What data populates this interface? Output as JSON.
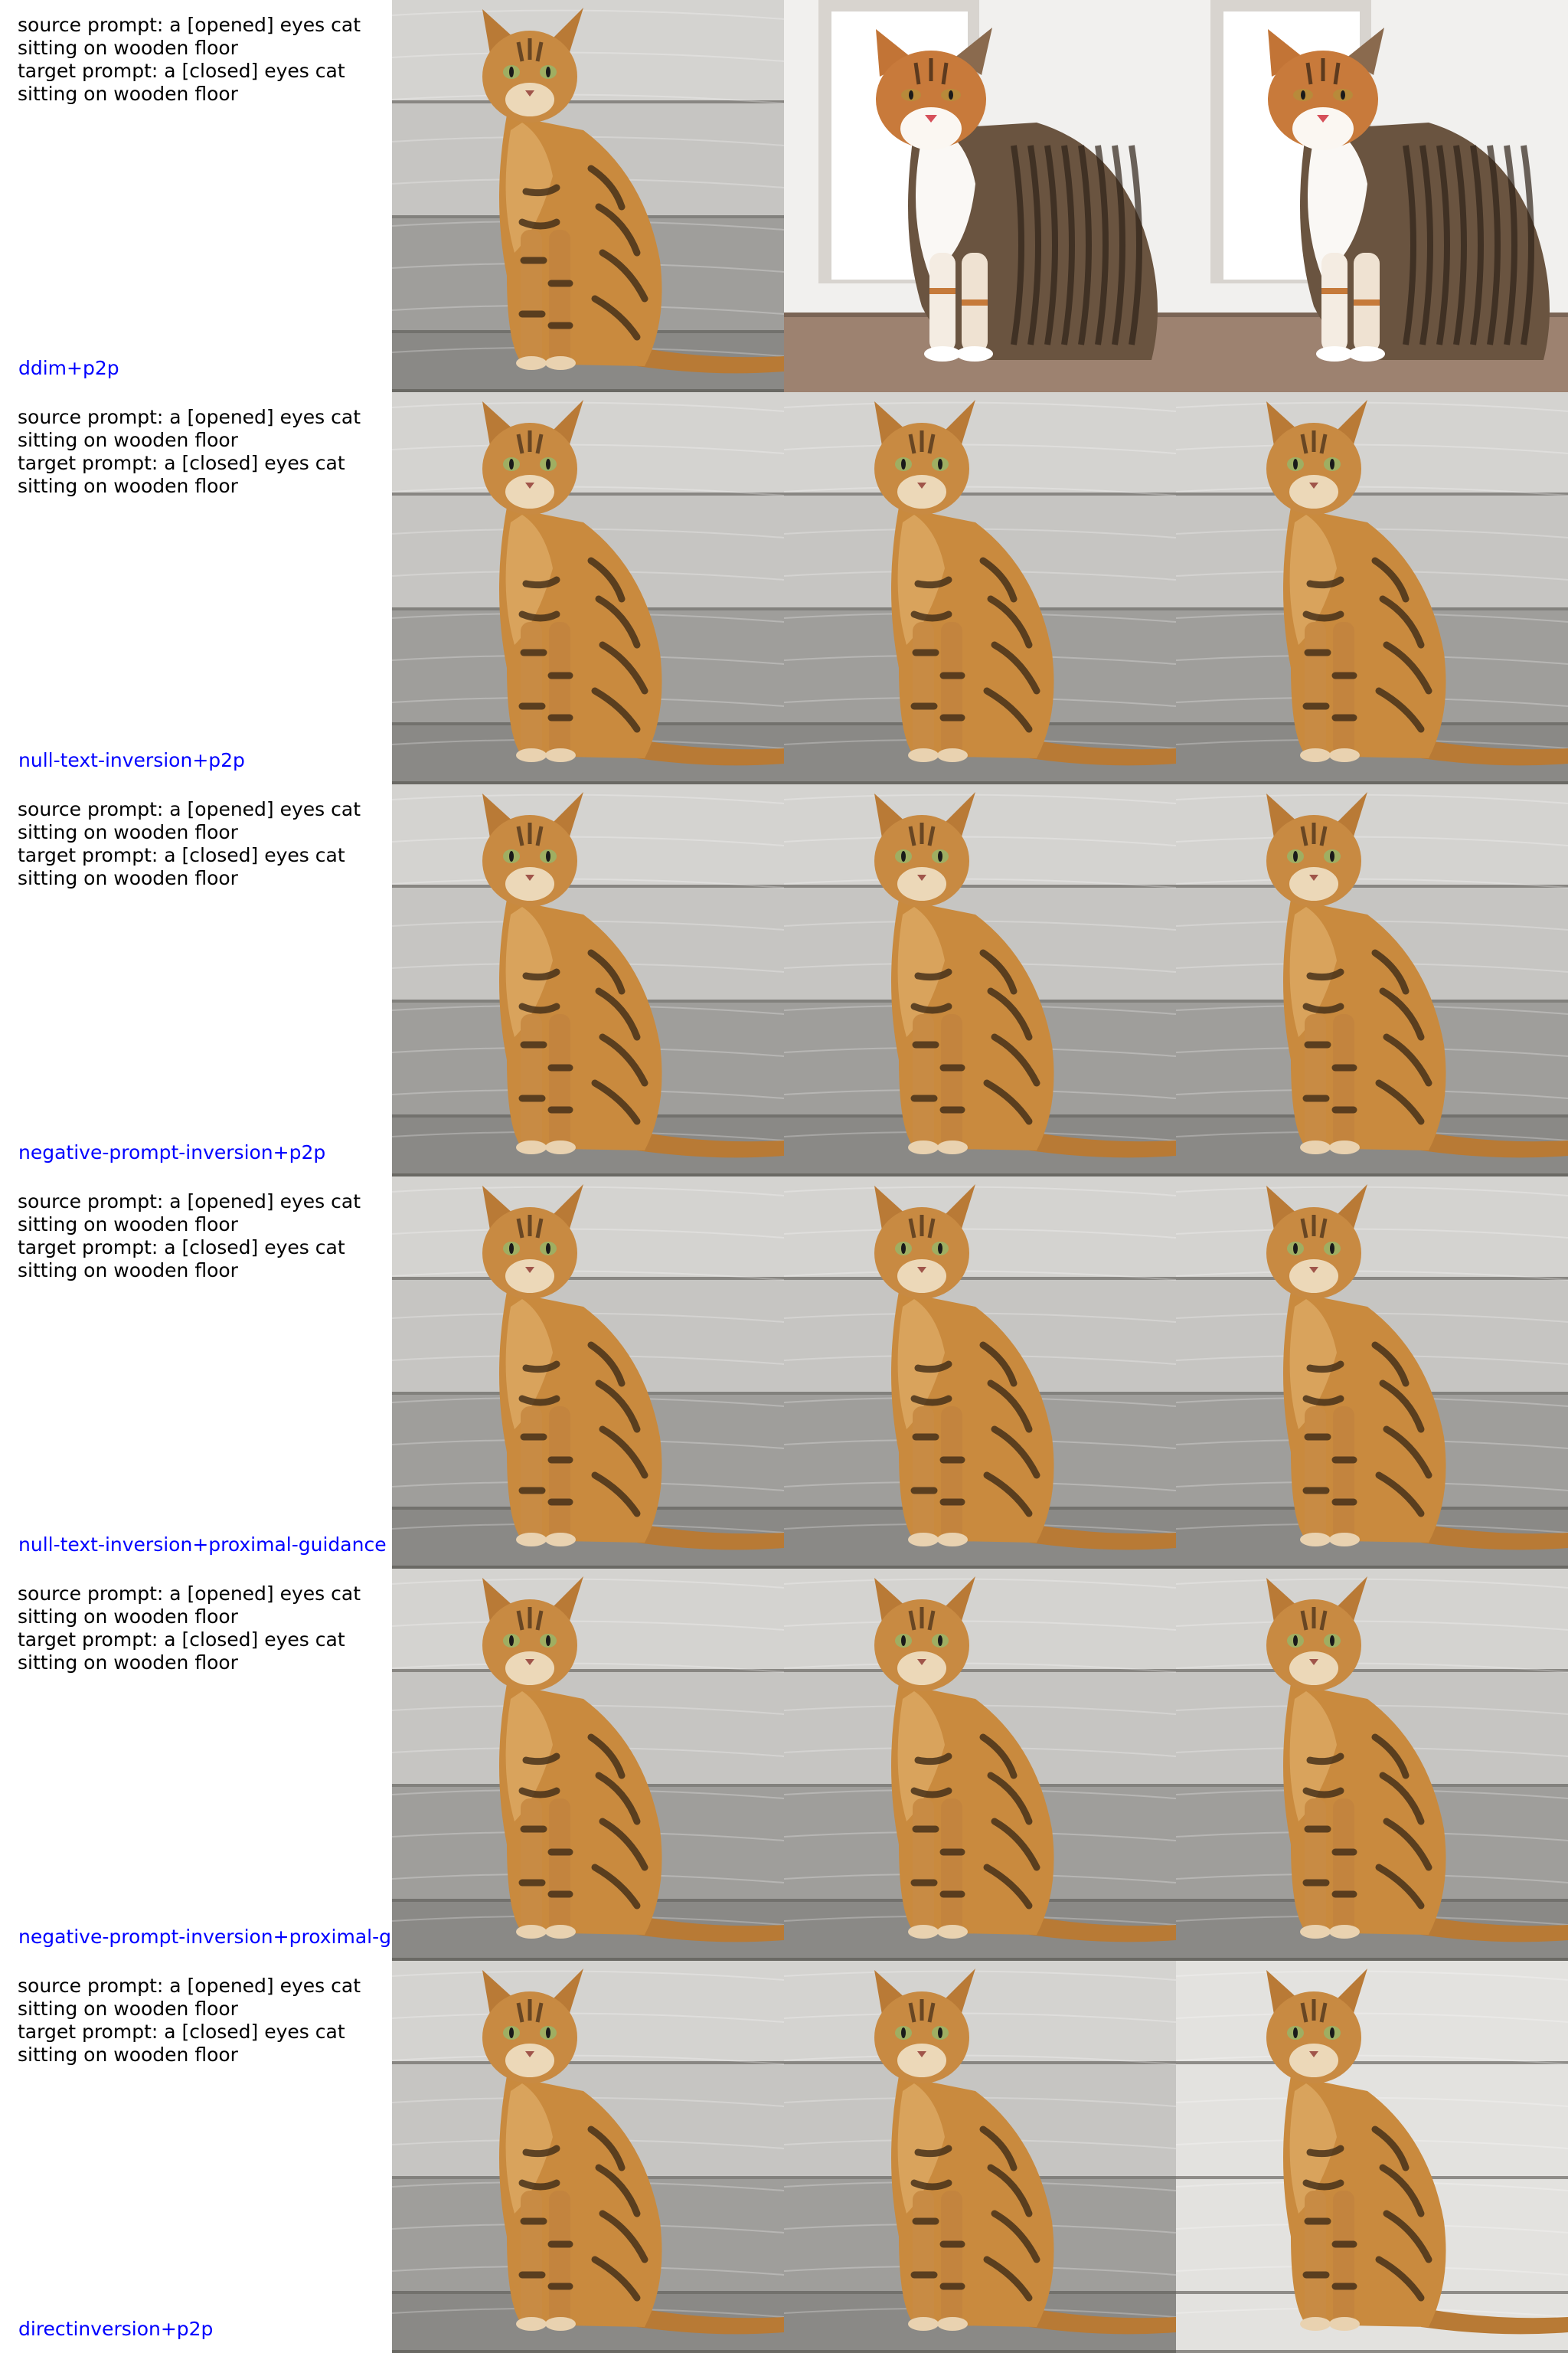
{
  "label_color": "#0000ff",
  "rows": [
    {
      "prompt": "source prompt: a [opened] eyes cat\nsitting on wooden floor\ntarget prompt: a [closed] eyes cat\nsitting on wooden floor",
      "method": "ddim+p2p",
      "images": [
        {
          "icon": "tabby-cat-photo",
          "scene": "wood-planks"
        },
        {
          "icon": "calico-cat-photo",
          "scene": "white-room"
        },
        {
          "icon": "calico-cat-photo",
          "scene": "white-room"
        }
      ]
    },
    {
      "prompt": "source prompt: a [opened] eyes cat\nsitting on wooden floor\ntarget prompt: a [closed] eyes cat\nsitting on wooden floor",
      "method": "null-text-inversion+p2p",
      "images": [
        {
          "icon": "tabby-cat-photo",
          "scene": "wood-planks"
        },
        {
          "icon": "tabby-cat-photo",
          "scene": "wood-planks"
        },
        {
          "icon": "tabby-cat-photo",
          "scene": "wood-planks"
        }
      ]
    },
    {
      "prompt": "source prompt: a [opened] eyes cat\nsitting on wooden floor\ntarget prompt: a [closed] eyes cat\nsitting on wooden floor",
      "method": "negative-prompt-inversion+p2p",
      "images": [
        {
          "icon": "tabby-cat-photo",
          "scene": "wood-planks"
        },
        {
          "icon": "tabby-cat-photo",
          "scene": "wood-planks"
        },
        {
          "icon": "tabby-cat-photo",
          "scene": "wood-planks"
        }
      ]
    },
    {
      "prompt": "source prompt: a [opened] eyes cat\nsitting on wooden floor\ntarget prompt: a [closed] eyes cat\nsitting on wooden floor",
      "method": "null-text-inversion+proximal-guidance",
      "images": [
        {
          "icon": "tabby-cat-photo",
          "scene": "wood-planks"
        },
        {
          "icon": "tabby-cat-photo",
          "scene": "wood-planks"
        },
        {
          "icon": "tabby-cat-photo",
          "scene": "wood-planks"
        }
      ]
    },
    {
      "prompt": "source prompt: a [opened] eyes cat\nsitting on wooden floor\ntarget prompt: a [closed] eyes cat\nsitting on wooden floor",
      "method": "negative-prompt-inversion+proximal-g",
      "images": [
        {
          "icon": "tabby-cat-photo",
          "scene": "wood-planks"
        },
        {
          "icon": "tabby-cat-photo",
          "scene": "wood-planks"
        },
        {
          "icon": "tabby-cat-photo",
          "scene": "wood-planks"
        }
      ]
    },
    {
      "prompt": "source prompt: a [opened] eyes cat\nsitting on wooden floor\ntarget prompt: a [closed] eyes cat\nsitting on wooden floor",
      "method": "directinversion+p2p",
      "images": [
        {
          "icon": "tabby-cat-photo",
          "scene": "wood-planks"
        },
        {
          "icon": "tabby-cat-photo",
          "scene": "wood-planks"
        },
        {
          "icon": "tabby-cat-photo",
          "scene": "wood-planks-bright"
        }
      ]
    }
  ]
}
